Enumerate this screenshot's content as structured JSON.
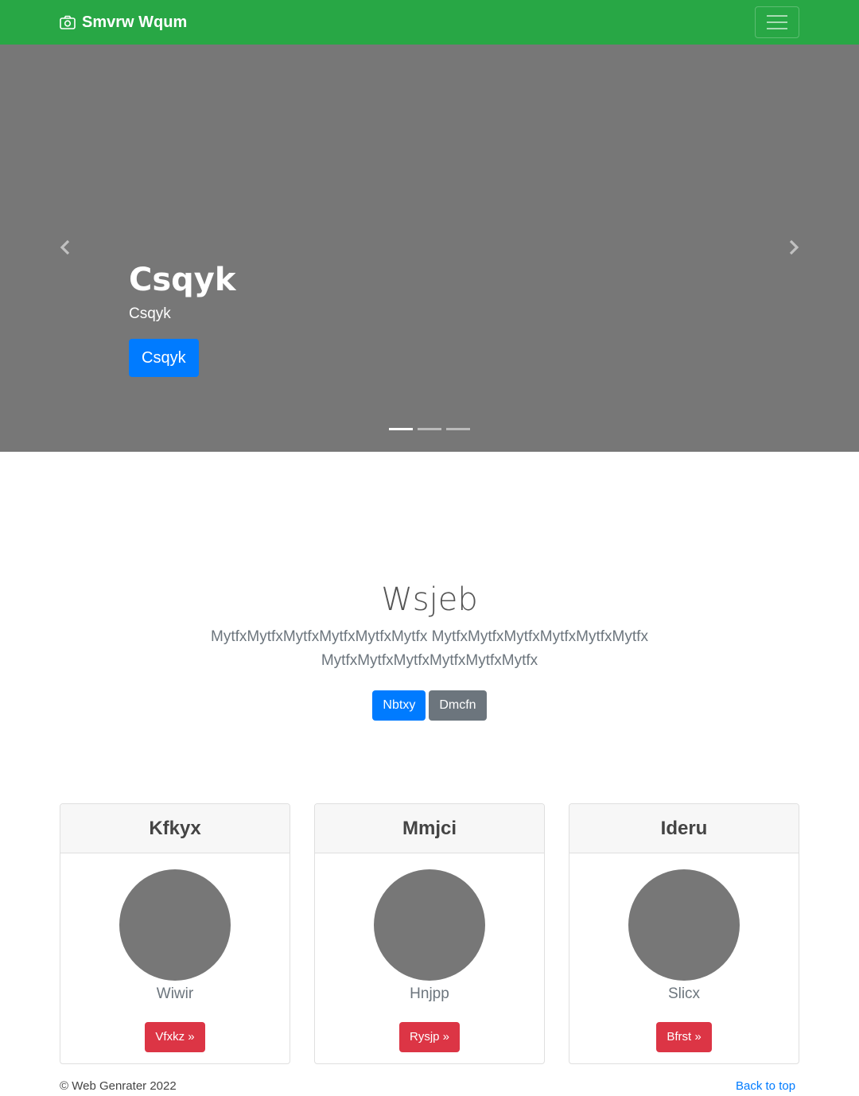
{
  "navbar": {
    "brand": "Smvrw Wqum",
    "brand_icon": "camera-icon",
    "toggler_icon": "hamburger-icon",
    "color": "#28a745"
  },
  "hero": {
    "title": "Csqyk",
    "subtitle": "Csqyk",
    "button_label": "Csqyk",
    "prev_icon": "chevron-left-icon",
    "next_icon": "chevron-right-icon",
    "slide_count": 3,
    "active_slide": 1
  },
  "jumbotron": {
    "title": "Wsjeb",
    "text": "MytfxMytfxMytfxMytfxMytfxMytfx MytfxMytfxMytfxMytfxMytfxMytfx MytfxMytfxMytfxMytfxMytfxMytfx",
    "primary_button": "Nbtxy",
    "secondary_button": "Dmcfn"
  },
  "cards": [
    {
      "title": "Kfkyx",
      "text": "Wiwir",
      "button": "Vfxkz »"
    },
    {
      "title": "Mmjci",
      "text": "Hnjpp",
      "button": "Rysjp »"
    },
    {
      "title": "Ideru",
      "text": "Slicx",
      "button": "Bfrst »"
    }
  ],
  "footer": {
    "copyright": "© Web Genrater 2022",
    "back_to_top": "Back to top"
  }
}
